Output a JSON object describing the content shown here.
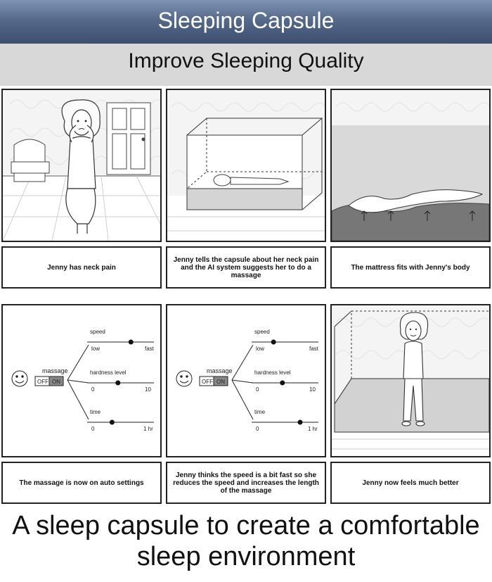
{
  "header": {
    "title": "Sleeping Capsule"
  },
  "subtitle": "Improve Sleeping Quality",
  "captions": [
    "Jenny has neck pain",
    "Jenny tells the capsule about her neck pain and the AI system suggests her to do a massage",
    "The mattress fits with Jenny's body",
    "The massage is now on auto settings",
    "Jenny thinks the speed is a bit fast so she reduces the speed and increases the length of the massage",
    "Jenny now feels much better"
  ],
  "settings": {
    "massage_label": "massage",
    "toggle_off": "OFF",
    "toggle_on": "ON",
    "speed_label": "speed",
    "speed_min": "low",
    "speed_max": "fast",
    "hardness_label": "hardness level",
    "hardness_min": "0",
    "hardness_max": "10",
    "time_label": "time",
    "time_min": "0",
    "time_max": "1 hr"
  },
  "levels": {
    "panel4": {
      "speed": 0.67,
      "hardness": 0.45,
      "time": 0.35
    },
    "panel5": {
      "speed": 0.3,
      "hardness": 0.45,
      "time": 0.75
    }
  },
  "footer": {
    "line1": "A sleep capsule to create a comfortable",
    "line2": "sleep environment"
  }
}
